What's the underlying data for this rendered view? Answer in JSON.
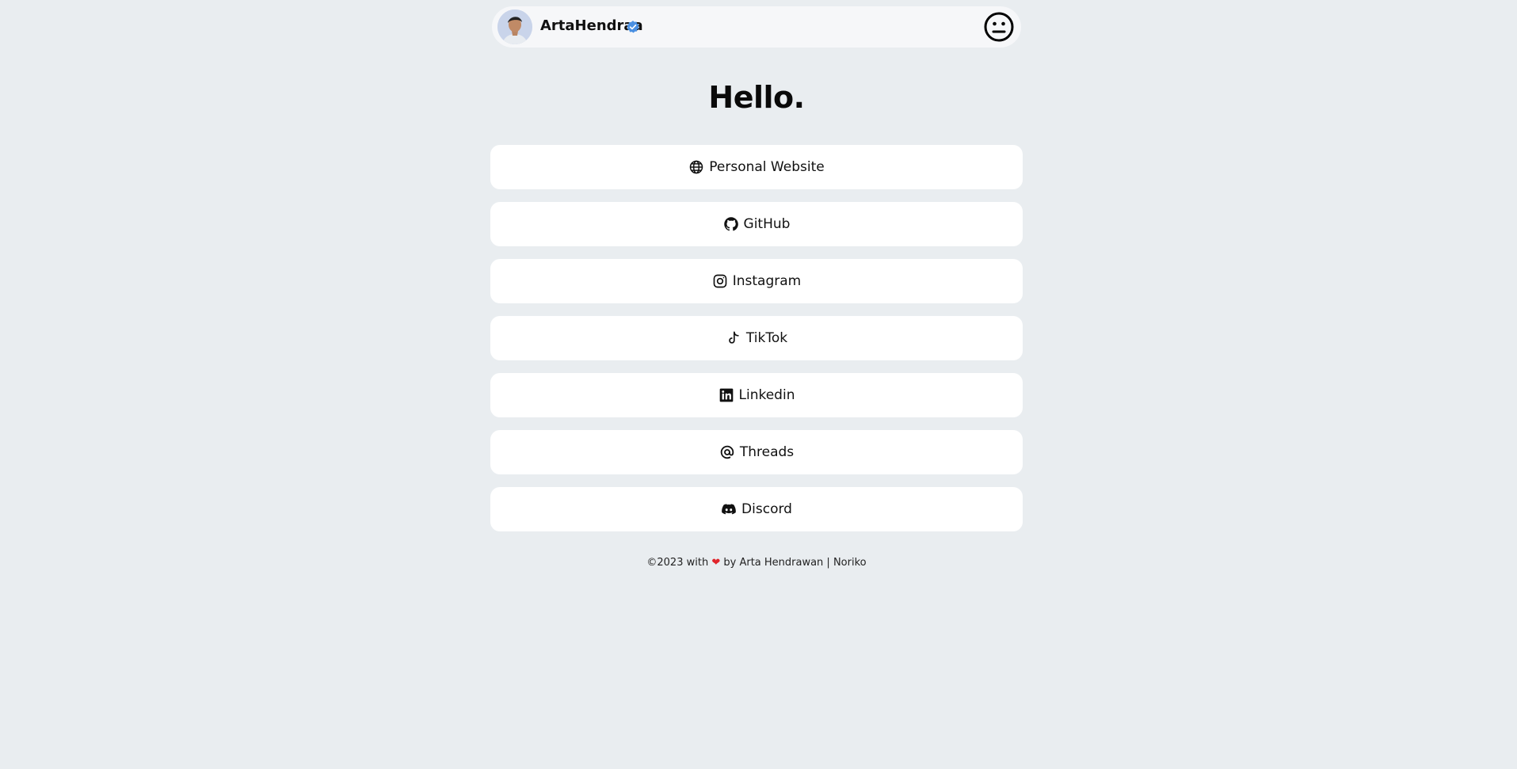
{
  "header": {
    "username": "ArtaHendraa",
    "avatar_icon": "avatar-photo",
    "verified_icon": "verified-badge-icon",
    "verified_color": "#4a90e2",
    "theme_toggle_icon": "neutral-face-icon"
  },
  "main": {
    "greeting": "Hello."
  },
  "links": [
    {
      "label": "Personal Website",
      "icon": "globe-icon"
    },
    {
      "label": "GitHub",
      "icon": "github-icon"
    },
    {
      "label": "Instagram",
      "icon": "instagram-icon"
    },
    {
      "label": "TikTok",
      "icon": "tiktok-icon"
    },
    {
      "label": "Linkedin",
      "icon": "linkedin-icon"
    },
    {
      "label": "Threads",
      "icon": "threads-icon"
    },
    {
      "label": "Discord",
      "icon": "discord-icon"
    }
  ],
  "footer": {
    "prefix": "©2023 with",
    "heart": "❤",
    "suffix": "by Arta Hendrawan | Noriko",
    "heart_color": "#e0242b"
  },
  "colors": {
    "background": "#e9edf0",
    "card": "#ffffff",
    "header": "#f6f7f9"
  }
}
